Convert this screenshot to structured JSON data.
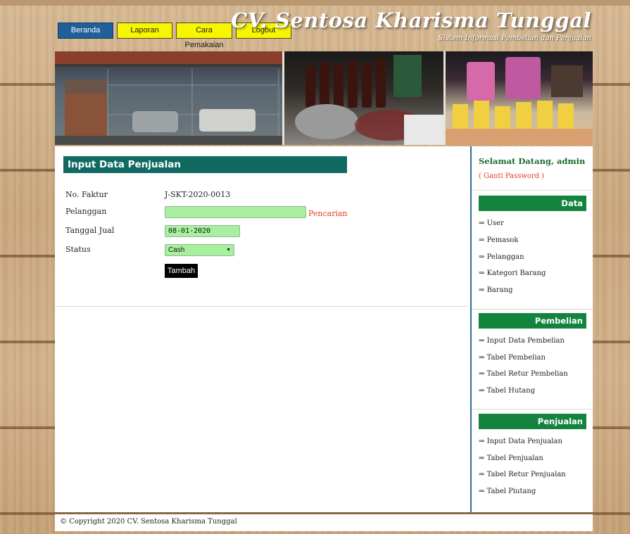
{
  "nav": [
    {
      "label": "Beranda",
      "active": true
    },
    {
      "label": "Laporan",
      "active": false
    },
    {
      "label": "Cara Pemakaian",
      "active": false
    },
    {
      "label": "Logout",
      "active": false
    }
  ],
  "brand": {
    "title": "CV. Sentosa Kharisma Tunggal",
    "subtitle": "Sistem Informasi Pembelian dan Penjualan"
  },
  "form": {
    "title": "Input Data Penjualan",
    "no_faktur_label": "No. Faktur",
    "no_faktur_value": "J-SKT-2020-0013",
    "pelanggan_label": "Pelanggan",
    "pelanggan_value": "",
    "pencarian_link": "Pencarian",
    "tanggal_label": "Tanggal Jual",
    "tanggal_value": "08-01-2020",
    "status_label": "Status",
    "status_value": "Cash",
    "submit_label": "Tambah"
  },
  "sidebar": {
    "welcome": "Selamat Datang, admin",
    "ganti_password": "( Ganti Password )",
    "sections": [
      {
        "title": "Data",
        "items": [
          "User",
          "Pemasok",
          "Pelanggan",
          "Kategori Barang",
          "Barang"
        ]
      },
      {
        "title": "Pembelian",
        "items": [
          "Input Data Pembelian",
          "Tabel Pembelian",
          "Tabel Retur Pembelian",
          "Tabel Hutang"
        ]
      },
      {
        "title": "Penjualan",
        "items": [
          "Input Data Penjualan",
          "Tabel Penjualan",
          "Tabel Retur Penjualan",
          "Tabel Piutang"
        ]
      }
    ],
    "arrow": "⇒"
  },
  "footer": {
    "copyright": "© Copyright 2020 CV. Sentosa Kharisma Tunggal"
  },
  "colors": {
    "nav_active": "#1f5f9a",
    "nav_yellow": "#f7f500",
    "form_title_bg": "#106a61",
    "section_head_bg": "#13843e",
    "input_bg": "#a8f0a0",
    "link_red": "#e23a2a"
  }
}
